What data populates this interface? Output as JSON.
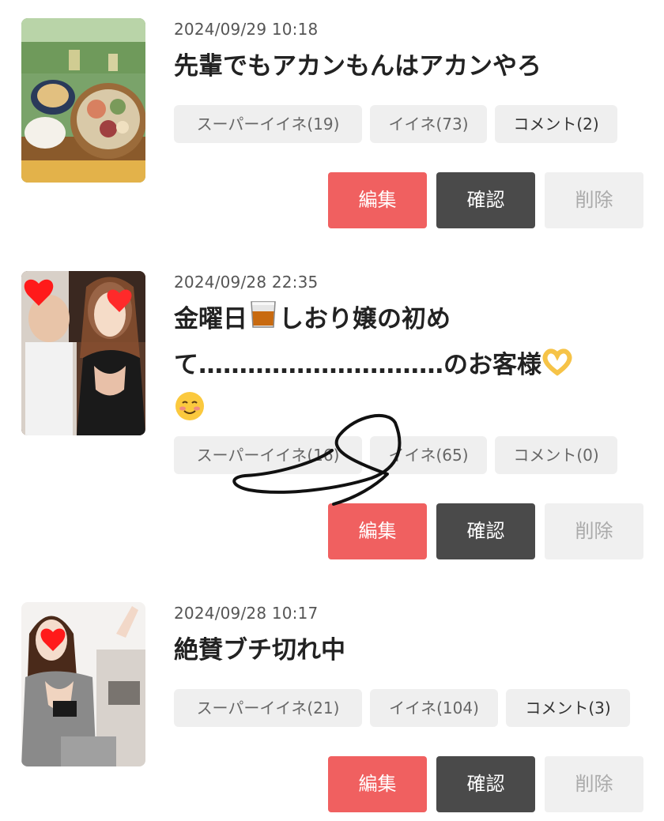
{
  "posts": [
    {
      "date": "2024/09/29 10:18",
      "title": "先輩でもアカンもんはアカンやろ",
      "stats": {
        "super_like": "スーパーイイネ(19)",
        "like": "イイネ(73)",
        "comment": "コメント(2)"
      },
      "actions": {
        "edit": "編集",
        "confirm": "確認",
        "delete": "削除"
      }
    },
    {
      "date": "2024/09/28 22:35",
      "title_part1": "金曜日",
      "title_part2": "しおり嬢の初めて…………………………のお客様",
      "stats": {
        "super_like": "スーパーイイネ(16)",
        "like": "イイネ(65)",
        "comment": "コメント(0)"
      },
      "actions": {
        "edit": "編集",
        "confirm": "確認",
        "delete": "削除"
      }
    },
    {
      "date": "2024/09/28 10:17",
      "title": "絶賛ブチ切れ中",
      "stats": {
        "super_like": "スーパーイイネ(21)",
        "like": "イイネ(104)",
        "comment": "コメント(3)"
      },
      "actions": {
        "edit": "編集",
        "confirm": "確認",
        "delete": "削除"
      }
    }
  ],
  "colors": {
    "edit": "#f06060",
    "confirm": "#4a4a4a",
    "delete": "#f0f0f0",
    "stat_bg": "#efefef"
  }
}
